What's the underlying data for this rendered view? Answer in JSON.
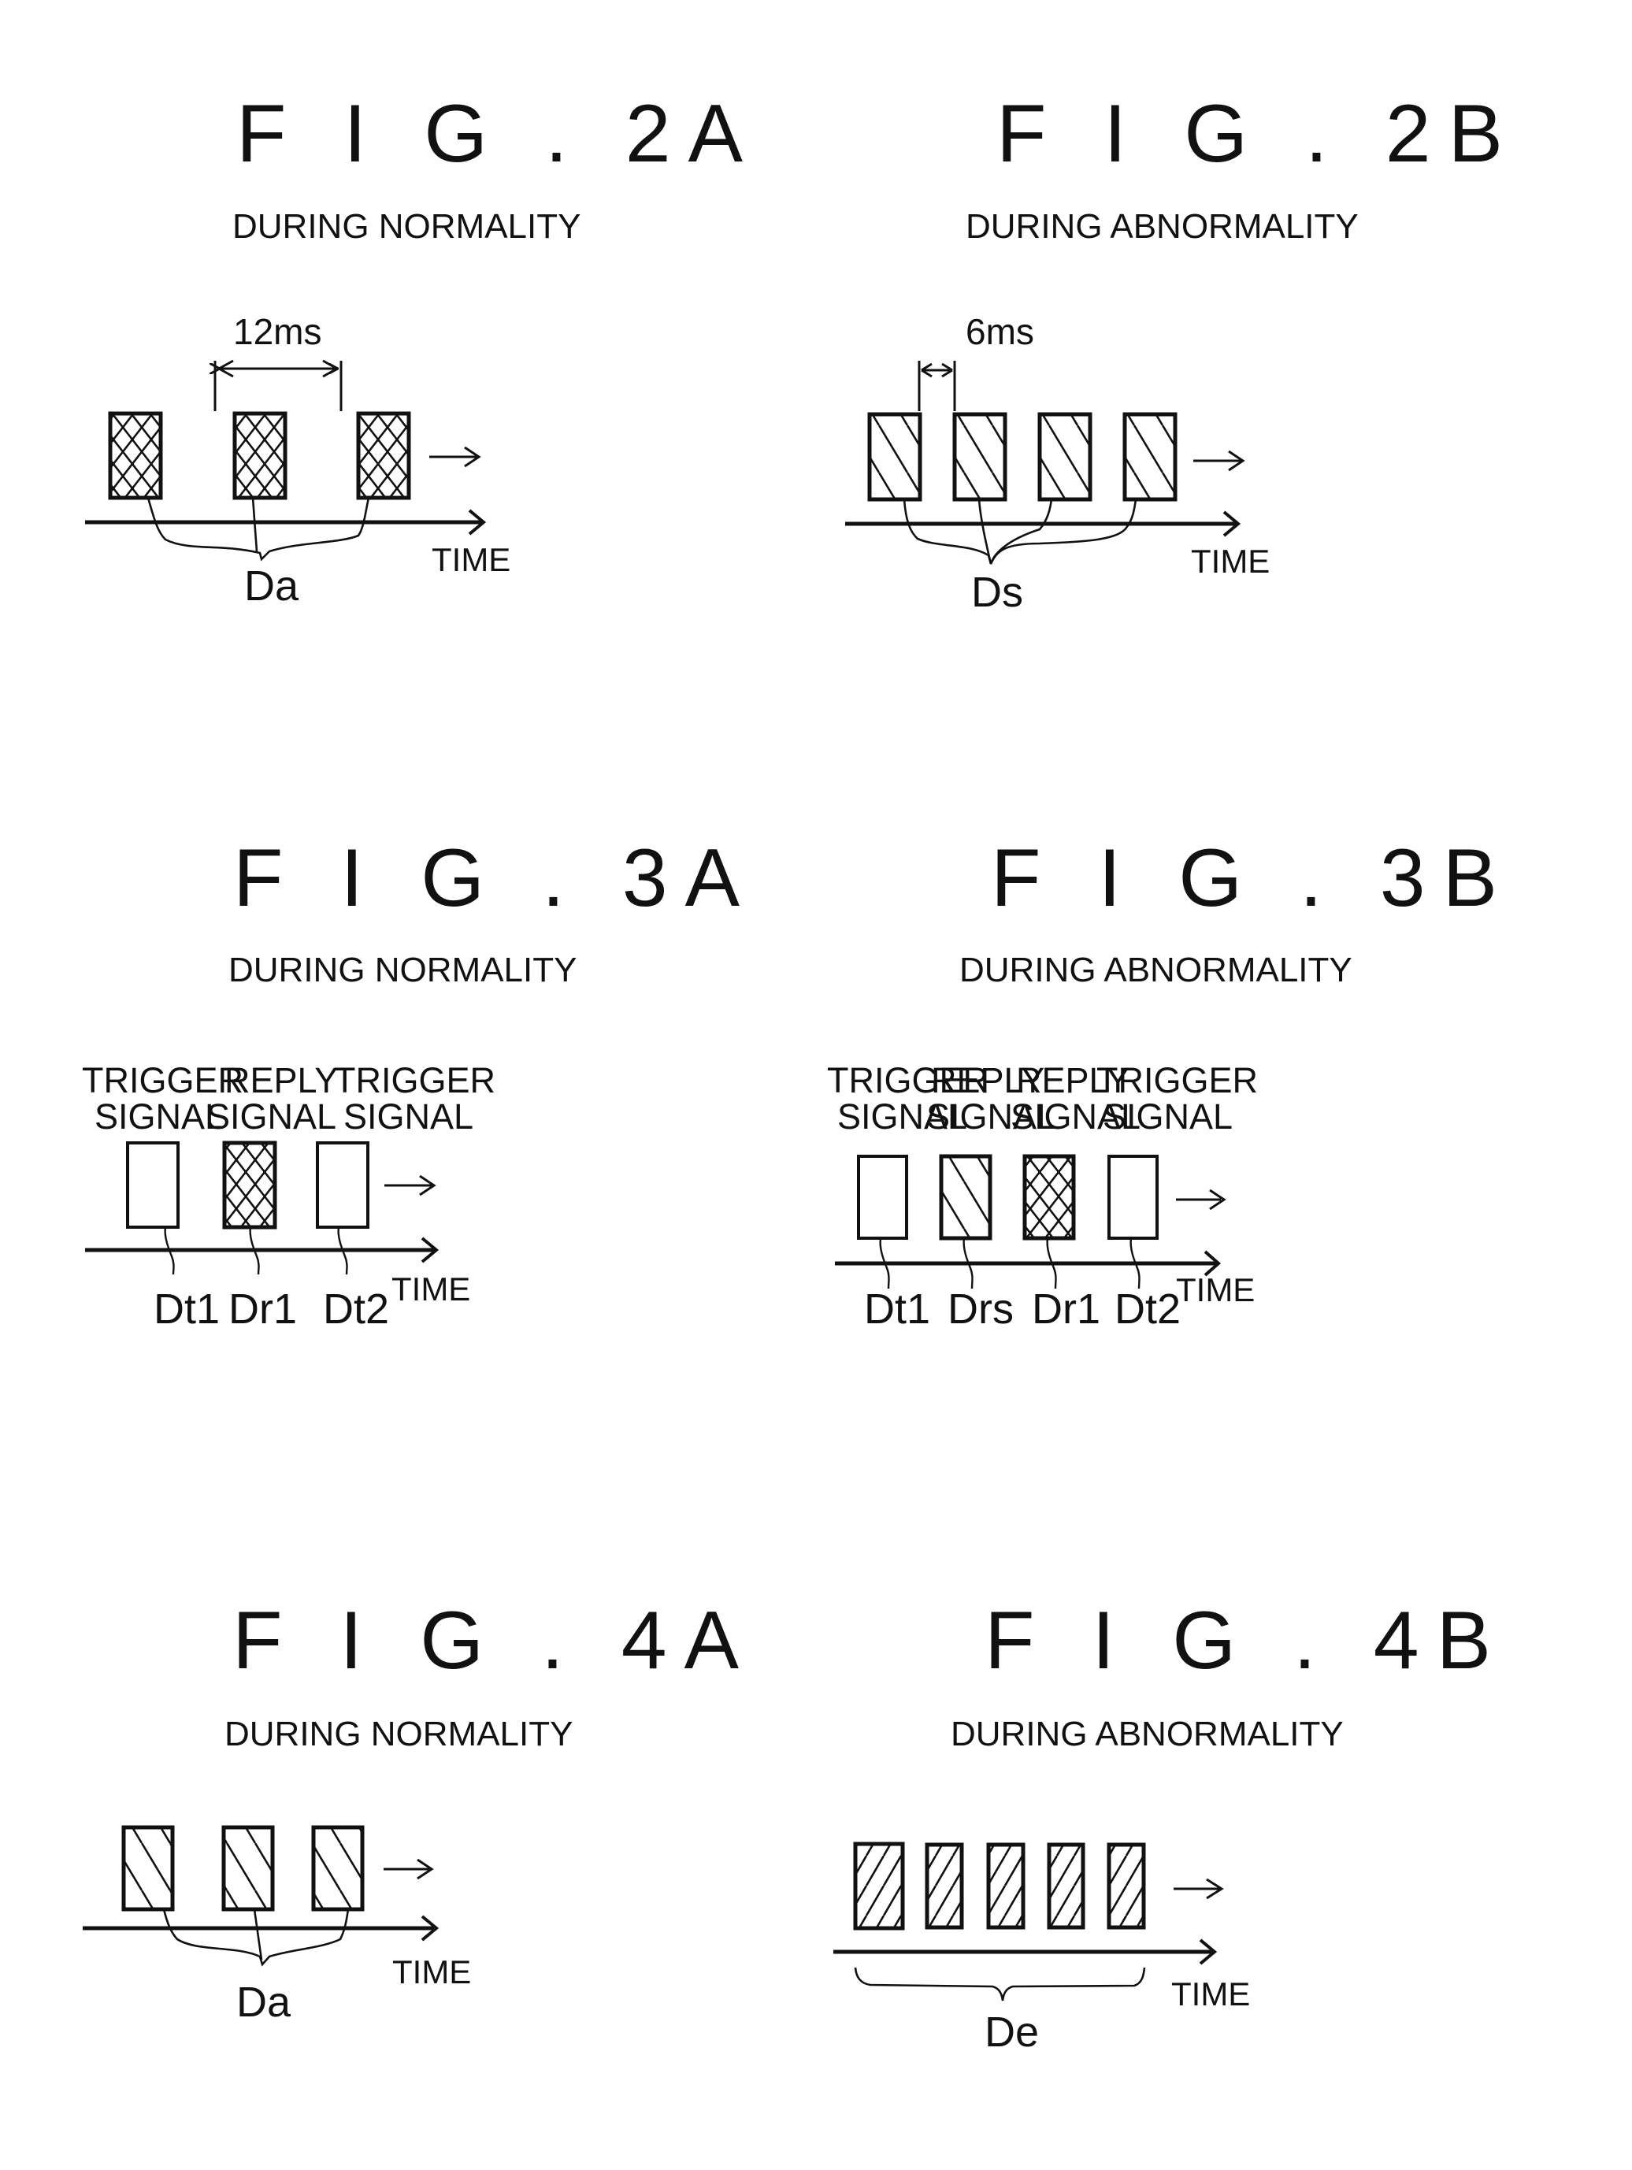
{
  "figures": [
    {
      "id": "2A",
      "title": "F I G . 2A",
      "subtitle": "DURING NORMALITY",
      "interval_label": "12ms",
      "time_label": "TIME",
      "blocks": [
        {
          "pattern": "crosshatch"
        },
        {
          "pattern": "crosshatch"
        },
        {
          "pattern": "crosshatch"
        }
      ],
      "group_labels": [
        {
          "text": "Da",
          "blocks": [
            0,
            1,
            2
          ]
        }
      ]
    },
    {
      "id": "2B",
      "title": "F I G . 2B",
      "subtitle": "DURING ABNORMALITY",
      "interval_label": "6ms",
      "time_label": "TIME",
      "blocks": [
        {
          "pattern": "hatch-back"
        },
        {
          "pattern": "hatch-back"
        },
        {
          "pattern": "hatch-back"
        },
        {
          "pattern": "hatch-back"
        }
      ],
      "group_labels": [
        {
          "text": "Ds",
          "blocks": [
            0,
            1,
            2,
            3
          ]
        }
      ]
    },
    {
      "id": "3A",
      "title": "F I G . 3A",
      "subtitle": "DURING NORMALITY",
      "time_label": "TIME",
      "blocks": [
        {
          "pattern": "none",
          "caption": [
            "TRIGGER",
            "SIGNAL"
          ],
          "label": "Dt1"
        },
        {
          "pattern": "crosshatch",
          "caption": [
            "REPLY",
            "SIGNAL"
          ],
          "label": "Dr1"
        },
        {
          "pattern": "none",
          "caption": [
            "TRIGGER",
            "SIGNAL"
          ],
          "label": "Dt2"
        }
      ]
    },
    {
      "id": "3B",
      "title": "F I G . 3B",
      "subtitle": "DURING ABNORMALITY",
      "time_label": "TIME",
      "blocks": [
        {
          "pattern": "none",
          "caption": [
            "TRIGGER",
            "SIGNAL"
          ],
          "label": "Dt1"
        },
        {
          "pattern": "hatch-back",
          "caption": [
            "REPLY",
            "SIGNAL"
          ],
          "label": "Drs"
        },
        {
          "pattern": "crosshatch",
          "caption": [
            "REPLY",
            "SIGNAL"
          ],
          "label": "Dr1"
        },
        {
          "pattern": "none",
          "caption": [
            "TRIGGER",
            "SIGNAL"
          ],
          "label": "Dt2"
        }
      ]
    },
    {
      "id": "4A",
      "title": "F I G . 4A",
      "subtitle": "DURING NORMALITY",
      "time_label": "TIME",
      "blocks": [
        {
          "pattern": "hatch-back"
        },
        {
          "pattern": "hatch-back"
        },
        {
          "pattern": "hatch-back"
        }
      ],
      "group_labels": [
        {
          "text": "Da",
          "blocks": [
            0,
            1,
            2
          ]
        }
      ]
    },
    {
      "id": "4B",
      "title": "F I G . 4B",
      "subtitle": "DURING ABNORMALITY",
      "time_label": "TIME",
      "blocks": [
        {
          "pattern": "hatch-fwd"
        },
        {
          "pattern": "hatch-fwd"
        },
        {
          "pattern": "hatch-fwd"
        },
        {
          "pattern": "hatch-fwd"
        },
        {
          "pattern": "hatch-fwd"
        }
      ],
      "group_labels": [
        {
          "text": "De",
          "blocks": [
            0,
            1,
            2,
            3,
            4
          ],
          "style": "brace"
        }
      ]
    }
  ]
}
